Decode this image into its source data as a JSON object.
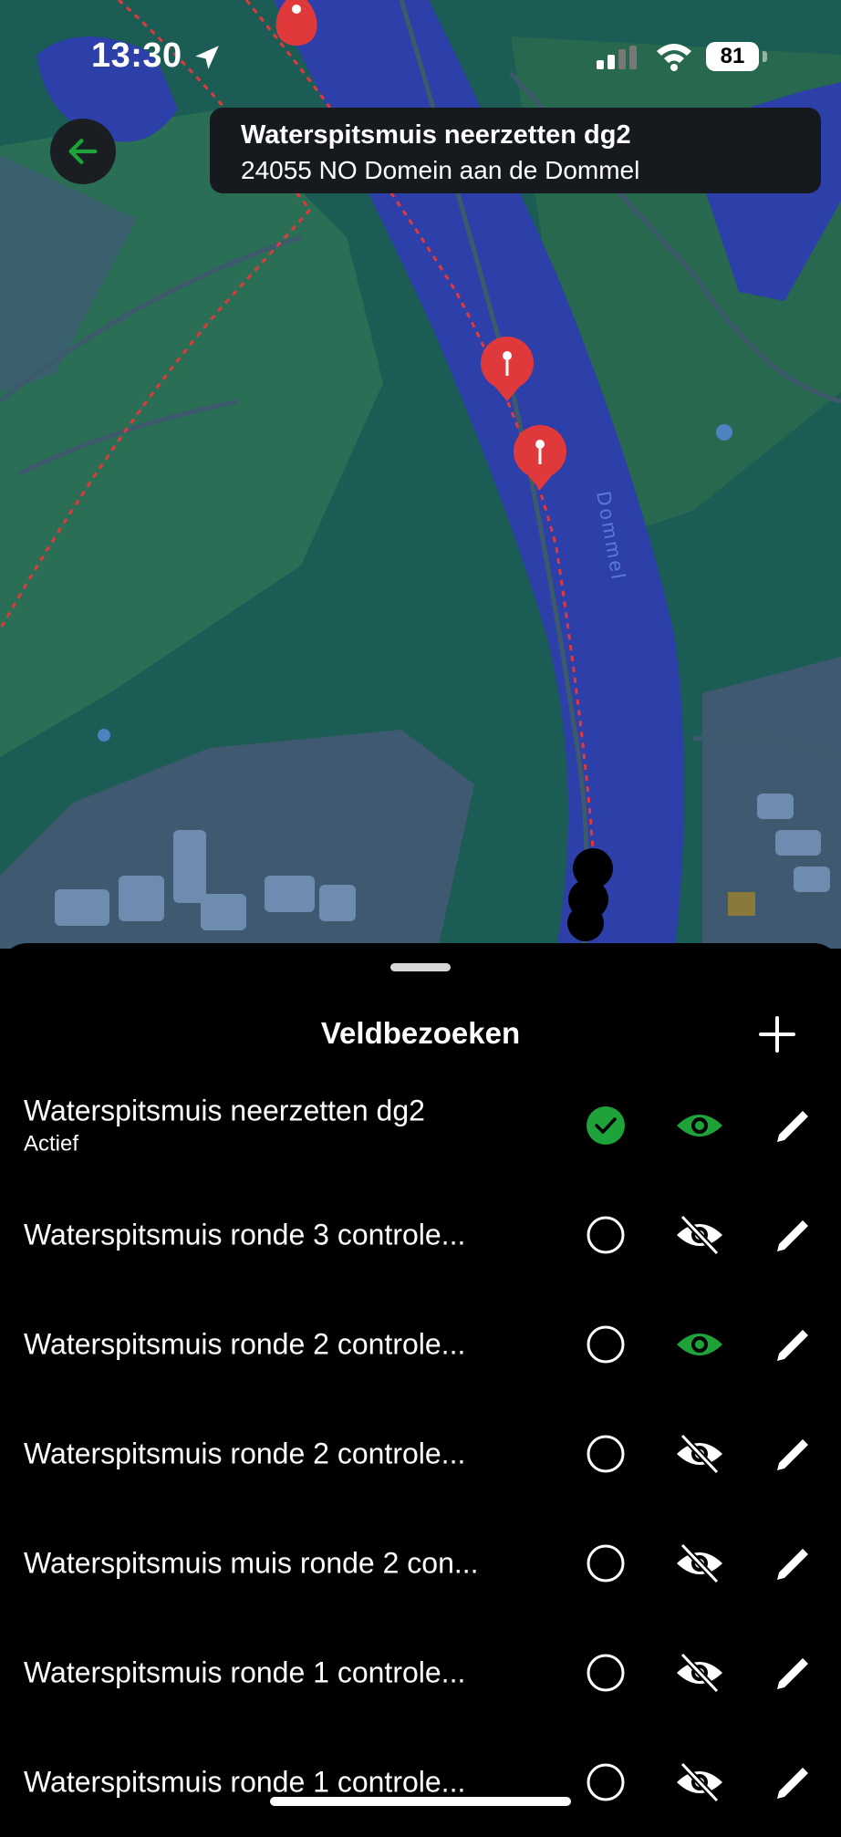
{
  "status_bar": {
    "time": "13:30",
    "battery": "81"
  },
  "header": {
    "title": "Waterspitsmuis neerzetten dg2",
    "subtitle": "24055 NO Domein aan de Dommel"
  },
  "map": {
    "river_label": "Dommel"
  },
  "sheet": {
    "title": "Veldbezoeken",
    "items": [
      {
        "label": "Waterspitsmuis neerzetten dg2",
        "sublabel": "Actief",
        "status": "checked",
        "visible": true
      },
      {
        "label": "Waterspitsmuis ronde 3 controle...",
        "sublabel": "",
        "status": "unchecked",
        "visible": false
      },
      {
        "label": "Waterspitsmuis ronde 2 controle...",
        "sublabel": "",
        "status": "unchecked",
        "visible": true
      },
      {
        "label": "Waterspitsmuis ronde 2 controle...",
        "sublabel": "",
        "status": "unchecked",
        "visible": false
      },
      {
        "label": "Waterspitsmuis muis ronde 2 con...",
        "sublabel": "",
        "status": "unchecked",
        "visible": false
      },
      {
        "label": "Waterspitsmuis ronde 1 controle...",
        "sublabel": "",
        "status": "unchecked",
        "visible": false
      },
      {
        "label": "Waterspitsmuis ronde 1 controle...",
        "sublabel": "",
        "status": "unchecked",
        "visible": false
      }
    ]
  },
  "colors": {
    "accent_green": "#1ea33a",
    "water": "#2d3fa8",
    "land": "#1b5c55",
    "route": "#e0393b"
  }
}
